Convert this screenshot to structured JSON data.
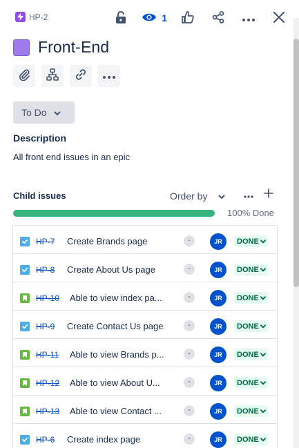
{
  "header": {
    "epic_key": "HP-2",
    "watch_count": "1"
  },
  "issue": {
    "title": "Front-End",
    "status": "To Do",
    "description_label": "Description",
    "description": "All front end issues in an epic"
  },
  "child_issues": {
    "label": "Child issues",
    "order_by": "Order by",
    "progress_label": "100% Done",
    "progress_fraction": 1.0,
    "items": [
      {
        "type": "task",
        "key": "HP-7",
        "summary": "Create Brands page",
        "priority": "-",
        "assignee": "JR",
        "status": "DONE"
      },
      {
        "type": "task",
        "key": "HP-8",
        "summary": "Create About Us page",
        "priority": "-",
        "assignee": "JR",
        "status": "DONE"
      },
      {
        "type": "story",
        "key": "HP-10",
        "summary": "Able to view index pa...",
        "priority": "-",
        "assignee": "JR",
        "status": "DONE"
      },
      {
        "type": "task",
        "key": "HP-9",
        "summary": "Create Contact Us page",
        "priority": "-",
        "assignee": "JR",
        "status": "DONE"
      },
      {
        "type": "story",
        "key": "HP-11",
        "summary": "Able to view Brands p...",
        "priority": "-",
        "assignee": "JR",
        "status": "DONE"
      },
      {
        "type": "story",
        "key": "HP-12",
        "summary": "Able to view About U...",
        "priority": "-",
        "assignee": "JR",
        "status": "DONE"
      },
      {
        "type": "story",
        "key": "HP-13",
        "summary": "Able to view Contact ...",
        "priority": "-",
        "assignee": "JR",
        "status": "DONE"
      },
      {
        "type": "task",
        "key": "HP-6",
        "summary": "Create index page",
        "priority": "-",
        "assignee": "JR",
        "status": "DONE"
      }
    ]
  },
  "colors": {
    "epic": "#904ee2",
    "epic_box": "#9f7aea",
    "progress": "#36b37e",
    "link": "#0052cc",
    "done_bg": "#e3fcef",
    "done_text": "#006644",
    "task_icon": "#4bade8",
    "story_icon": "#63ba3c"
  },
  "icons": {
    "epic": "lightning-icon",
    "lock": "unlock-icon",
    "watch": "eye-icon",
    "vote": "thumbs-up-icon",
    "share": "share-icon",
    "more": "more-icon",
    "close": "close-icon",
    "attach": "paperclip-icon",
    "child": "hierarchy-icon",
    "link": "link-icon"
  }
}
